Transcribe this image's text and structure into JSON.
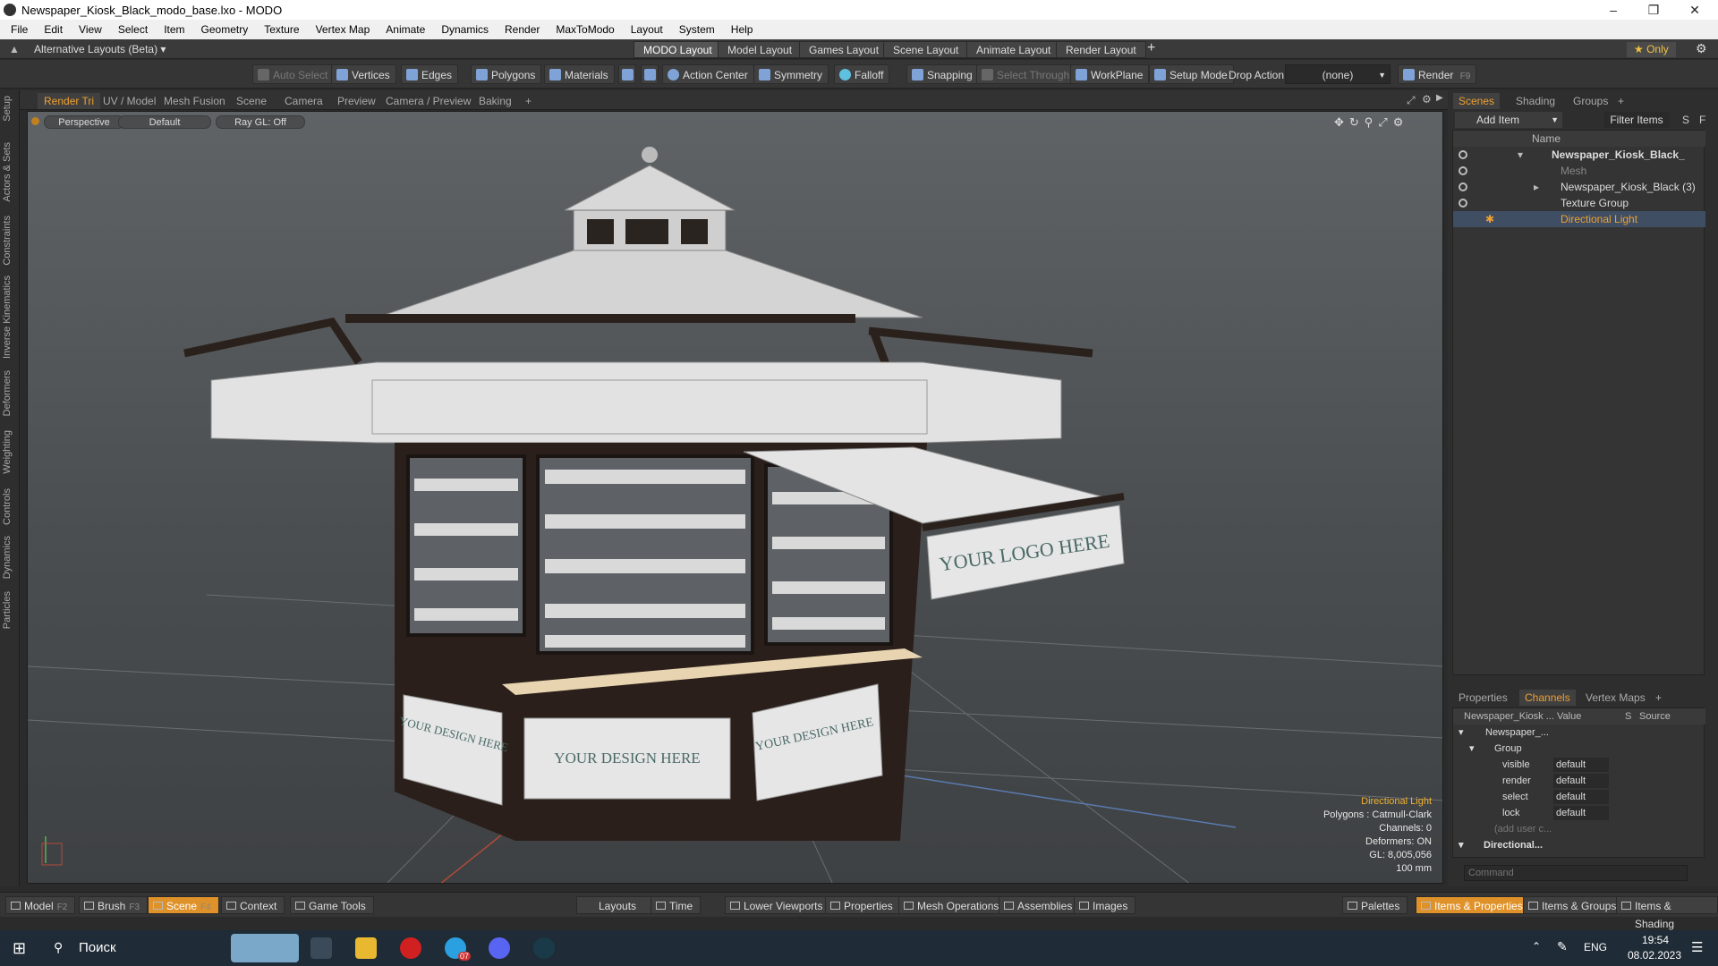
{
  "window": {
    "title": "Newspaper_Kiosk_Black_modo_base.lxo - MODO",
    "min": "–",
    "max": "❐",
    "close": "✕"
  },
  "menu": [
    "File",
    "Edit",
    "View",
    "Select",
    "Item",
    "Geometry",
    "Texture",
    "Vertex Map",
    "Animate",
    "Dynamics",
    "Render",
    "MaxToModo",
    "Layout",
    "System",
    "Help"
  ],
  "layoutbar": {
    "alt": "Alternative Layouts (Beta) ▾",
    "tabs": [
      "MODO Layout",
      "Model Layout",
      "Games Layout",
      "Scene Layout",
      "Animate Layout",
      "Render Layout"
    ],
    "plus": "+",
    "only": "★ Only",
    "gear": "⚙"
  },
  "toolbar": {
    "auto_select": "Auto Select",
    "vertices": "Vertices",
    "edges": "Edges",
    "polygons": "Polygons",
    "materials": "Materials",
    "action_center": "Action Center",
    "symmetry": "Symmetry",
    "falloff": "Falloff",
    "snapping": "Snapping",
    "select_through": "Select Through",
    "workplane": "WorkPlane",
    "setup_mode": "Setup Mode",
    "drop_action": "Drop Action",
    "drop_value": "(none)",
    "render": "Render",
    "render_key": "F9"
  },
  "vtabs": [
    "Render Tri",
    "UV / Model",
    "Mesh Fusion",
    "Scene",
    "Camera",
    "Preview",
    "Camera / Preview",
    "Baking",
    "+"
  ],
  "leftstrip": [
    "Setup",
    "Actors & Sets",
    "Constraints",
    "Inverse Kinematics",
    "Deformers",
    "Weighting",
    "Controls",
    "Dynamics",
    "Particles"
  ],
  "viewport": {
    "perspective": "Perspective",
    "default": "Default",
    "raygl": "Ray GL: Off",
    "logo_text": "YOUR LOGO HERE",
    "design_left": "YOUR DESIGN HERE",
    "design_center": "YOUR DESIGN HERE",
    "design_right": "YOUR DESIGN HERE",
    "info": {
      "item": "Directional Light",
      "polygons": "Polygons : Catmull-Clark",
      "channels": "Channels: 0",
      "deformers": "Deformers: ON",
      "gl": "GL: 8,005,056",
      "scale": "100 mm"
    }
  },
  "scenes": {
    "tabs": [
      "Scenes",
      "Shading",
      "Groups",
      "+"
    ],
    "add_item": "Add Item",
    "filter": "Filter Items",
    "s": "S",
    "f": "F",
    "col_name": "Name",
    "items": [
      {
        "label": "Newspaper_Kiosk_Black_"
      },
      {
        "label": "Mesh"
      },
      {
        "label": "Newspaper_Kiosk_Black (3)"
      },
      {
        "label": "Texture Group"
      },
      {
        "label": "Directional Light"
      }
    ]
  },
  "channels": {
    "tabs": [
      "Properties",
      "Channels",
      "Vertex Maps",
      "+"
    ],
    "cols": [
      "Newspaper_Kiosk ...",
      "Value",
      "S",
      "Source"
    ],
    "root": "Newspaper_...",
    "group": "Group",
    "rows": [
      {
        "name": "visible",
        "value": "default"
      },
      {
        "name": "render",
        "value": "default"
      },
      {
        "name": "select",
        "value": "default"
      },
      {
        "name": "lock",
        "value": "default"
      }
    ],
    "add_user": "(add user c...",
    "directional": "Directional..."
  },
  "command": {
    "placeholder": "Command"
  },
  "bottombar": {
    "model": "Model",
    "model_key": "F2",
    "brush": "Brush",
    "brush_key": "F3",
    "scene": "Scene",
    "scene_key": "F4",
    "context": "Context",
    "game_tools": "Game Tools",
    "layouts": "Layouts",
    "time": "Time",
    "lower_viewports": "Lower Viewports",
    "properties": "Properties",
    "mesh_ops": "Mesh Operations",
    "assemblies": "Assemblies",
    "images": "Images",
    "palettes": "Palettes",
    "items_props": "Items & Properties",
    "items_groups": "Items & Groups",
    "items_shading": "Items & Shading"
  },
  "taskbar": {
    "search": "Поиск",
    "lang": "ENG",
    "time": "19:54",
    "date": "08.02.2023",
    "badge": "07"
  }
}
